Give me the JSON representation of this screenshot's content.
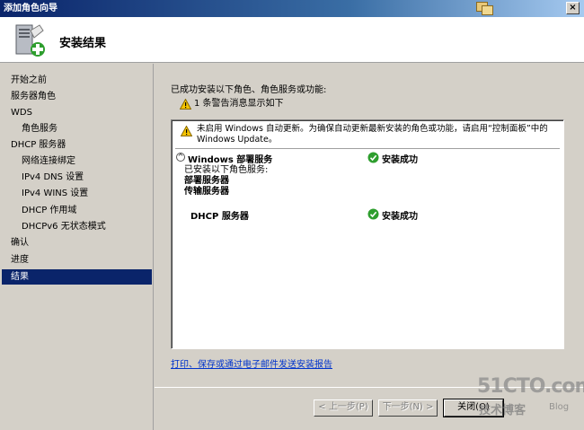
{
  "window": {
    "title": "添加角色向导",
    "close_glyph": "×"
  },
  "header": {
    "title": "安装结果"
  },
  "nav": {
    "items": [
      {
        "label": "开始之前",
        "sub": false,
        "selected": false
      },
      {
        "label": "服务器角色",
        "sub": false,
        "selected": false
      },
      {
        "label": "WDS",
        "sub": false,
        "selected": false
      },
      {
        "label": "角色服务",
        "sub": true,
        "selected": false
      },
      {
        "label": "DHCP 服务器",
        "sub": false,
        "selected": false
      },
      {
        "label": "网络连接绑定",
        "sub": true,
        "selected": false
      },
      {
        "label": "IPv4 DNS 设置",
        "sub": true,
        "selected": false
      },
      {
        "label": "IPv4 WINS 设置",
        "sub": true,
        "selected": false
      },
      {
        "label": "DHCP 作用域",
        "sub": true,
        "selected": false
      },
      {
        "label": "DHCPv6 无状态模式",
        "sub": true,
        "selected": false
      },
      {
        "label": "确认",
        "sub": false,
        "selected": false
      },
      {
        "label": "进度",
        "sub": false,
        "selected": false
      },
      {
        "label": "结果",
        "sub": false,
        "selected": true
      }
    ]
  },
  "main": {
    "intro": "已成功安装以下角色、角色服务或功能:",
    "warning_summary": "1 条警告消息显示如下",
    "results": {
      "warning_message": "未启用 Windows 自动更新。为确保自动更新最新安装的角色或功能，请启用“控制面板”中的 Windows Update。",
      "roles": [
        {
          "name": "Windows 部署服务",
          "status": "安装成功",
          "collapse_glyph": "^"
        },
        {
          "name": "DHCP 服务器",
          "status": "安装成功"
        }
      ],
      "details_heading": "已安装以下角色服务:",
      "services": [
        "部署服务器",
        "传输服务器"
      ]
    },
    "report_link": "打印、保存或通过电子邮件发送安装报告"
  },
  "buttons": {
    "prev": "< 上一步(P)",
    "next": "下一步(N) >",
    "close": "关闭(O)"
  },
  "watermark": {
    "big": "51CTO.com",
    "small": "技术博客",
    "blog": "Blog"
  },
  "colors": {
    "selection": "#0a246a",
    "link": "#0033cc",
    "success": "#2e9e2e",
    "warning": "#f5c400"
  }
}
